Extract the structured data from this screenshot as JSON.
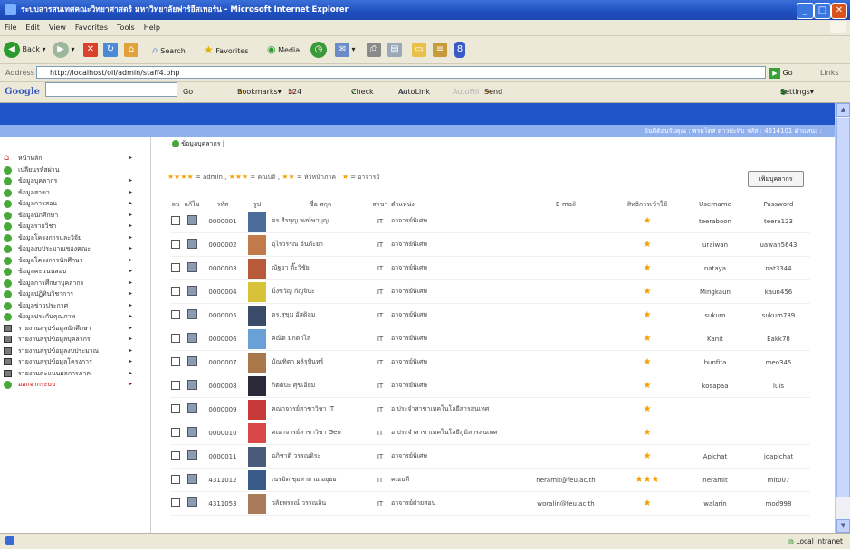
{
  "window": {
    "title": "ระบบสารสนเทศคณะวิทยาศาสตร์ มหาวิทยาลัยฟาร์อีสเทอร์น - Microsoft Internet Explorer",
    "minimize": "_",
    "maximize": "□",
    "close": "✕"
  },
  "menu": [
    "File",
    "Edit",
    "View",
    "Favorites",
    "Tools",
    "Help"
  ],
  "toolbar": {
    "back": "Back",
    "search": "Search",
    "favorites": "Favorites",
    "media": "Media"
  },
  "address": {
    "label": "Address",
    "url": "http://localhost/oil/admin/staff4.php",
    "go": "Go",
    "links": "Links"
  },
  "google": {
    "logo": "Google",
    "go": "Go",
    "bookmarks": "Bookmarks▾",
    "blocked": "324 blocked",
    "check": "Check ▾",
    "autolink": "AutoLink ▾",
    "autofill": "AutoFill",
    "sendto": "Send to▾",
    "settings": "Settings▾"
  },
  "header": {
    "welcome": "ยินดีต้อนรับคุณ : พรมโตศ ตาวปะทิบ รหัส : 4514101 ตำแหน่ง :"
  },
  "sidebar": [
    {
      "label": "หน้าหลัก",
      "icon": "home",
      "arrow": "▸"
    },
    {
      "label": "เปลี่ยนรหัสผ่าน",
      "icon": "dot",
      "arrow": ""
    },
    {
      "label": "ข้อมูลบุคลากร",
      "icon": "dot",
      "arrow": "▸"
    },
    {
      "label": "ข้อมูลสาขา",
      "icon": "dot",
      "arrow": "▸"
    },
    {
      "label": "ข้อมูลการสอน",
      "icon": "dot",
      "arrow": "▸"
    },
    {
      "label": "ข้อมูลนักศึกษา",
      "icon": "dot",
      "arrow": "▸"
    },
    {
      "label": "ข้อมูลรายวิชา",
      "icon": "dot",
      "arrow": "▸"
    },
    {
      "label": "ข้อมูลโครงการและวิจัย",
      "icon": "dot",
      "arrow": "▸"
    },
    {
      "label": "ข้อมูลงบประมาณของคณะ",
      "icon": "dot",
      "arrow": "▸"
    },
    {
      "label": "ข้อมูลโครงการนักศึกษา",
      "icon": "dot",
      "arrow": "▸"
    },
    {
      "label": "ข้อมูลคะแนนสอบ",
      "icon": "dot",
      "arrow": "▸"
    },
    {
      "label": "ข้อมูลการศึกษาบุคลากร",
      "icon": "dot",
      "arrow": "▸"
    },
    {
      "label": "ข้อมูลปฏิทินวิชาการ",
      "icon": "dot",
      "arrow": "▸"
    },
    {
      "label": "ข้อมูลข่าวประกาศ",
      "icon": "dot",
      "arrow": "▸"
    },
    {
      "label": "ข้อมูลประกันคุณภาพ",
      "icon": "dot",
      "arrow": "▸"
    },
    {
      "label": "รายงานสรุปข้อมูลนักศึกษา",
      "icon": "book",
      "arrow": "▸"
    },
    {
      "label": "รายงานสรุปข้อมูลบุคลากร",
      "icon": "book",
      "arrow": "▸"
    },
    {
      "label": "รายงานสรุปข้อมูลงบประมาณ",
      "icon": "book",
      "arrow": "▸"
    },
    {
      "label": "รายงานสรุปข้อมูลโครงการ",
      "icon": "book",
      "arrow": "▸"
    },
    {
      "label": "รายงานคะแนนผลการภาค",
      "icon": "book",
      "arrow": "▸"
    },
    {
      "label": "ออกจากระบบ",
      "icon": "dot",
      "arrow": "▸"
    }
  ],
  "content": {
    "breadcrumb": "ข้อมูลบุคลากร |",
    "legend": {
      "s4": "★★★★",
      "l4": "= admin ,",
      "s3": "★★★",
      "l3": "= คณบดี ,",
      "s2": "★★",
      "l2": "= หัวหน้าภาค ,",
      "s1": "★",
      "l1": "= อาจารย์"
    },
    "add_button": "เพิ่มบุคลากร",
    "columns": [
      "ลบ",
      "แก้ไข",
      "รหัส",
      "รูป",
      "ชื่อ-สกุล",
      "สาขา",
      "ตำแหน่ง",
      "E-mail",
      "สิทธิการเข้าใช้",
      "Username",
      "Password"
    ],
    "rows": [
      {
        "id": "0000001",
        "name": "ดร.ธีรบุญ พงษ์ษาบุญ",
        "branch": "IT",
        "position": "อาจารย์พิเศษ",
        "email": "",
        "stars": "★",
        "username": "teeraboon",
        "password": "teera123"
      },
      {
        "id": "0000002",
        "name": "อุไรวรรณ อินต๊ะยา",
        "branch": "IT",
        "position": "อาจารย์พิเศษ",
        "email": "",
        "stars": "★",
        "username": "uraiwan",
        "password": "uawan5643"
      },
      {
        "id": "0000003",
        "name": "ณัฐยา ตั๊ะวิชัย",
        "branch": "IT",
        "position": "อาจารย์พิเศษ",
        "email": "",
        "stars": "★",
        "username": "nataya",
        "password": "nat3344"
      },
      {
        "id": "0000004",
        "name": "มิ่งขวัญ กัญจินะ",
        "branch": "IT",
        "position": "อาจารย์พิเศษ",
        "email": "",
        "stars": "★",
        "username": "Mingkaun",
        "password": "kaun456"
      },
      {
        "id": "0000005",
        "name": "ดร.สุขุม อัสดิลม",
        "branch": "IT",
        "position": "อาจารย์พิเศษ",
        "email": "",
        "stars": "★",
        "username": "sukum",
        "password": "sukum789"
      },
      {
        "id": "0000006",
        "name": "คณิต มุกดาไล",
        "branch": "IT",
        "position": "อาจารย์พิเศษ",
        "email": "",
        "stars": "★",
        "username": "Kanit",
        "password": "Eakk78"
      },
      {
        "id": "0000007",
        "name": "บัณฑิตา ผลิรุปันทร์",
        "branch": "IT",
        "position": "อาจารย์พิเศษ",
        "email": "",
        "stars": "★",
        "username": "bunfita",
        "password": "meo345"
      },
      {
        "id": "0000008",
        "name": "กิตติปะ ศุขเอียม",
        "branch": "IT",
        "position": "อาจารย์พิเศษ",
        "email": "",
        "stars": "★",
        "username": "kosapaa",
        "password": "luis"
      },
      {
        "id": "0000009",
        "name": "คณาจารย์สาขาวิชา IT",
        "branch": "IT",
        "position": "อ.ประจำสาขาเทคโนโลยีสารสนเทศ",
        "email": "",
        "stars": "★",
        "username": "",
        "password": ""
      },
      {
        "id": "0000010",
        "name": "คณาจารย์สาขาวิชา Geo",
        "branch": "IT",
        "position": "อ.ประจำสาขาเทคโนโลยีภูมิสารสนเทศ",
        "email": "",
        "stars": "★",
        "username": "",
        "password": ""
      },
      {
        "id": "0000011",
        "name": "อภิชาติ วรรณดิระ",
        "branch": "IT",
        "position": "อาจารย์พิเศษ",
        "email": "",
        "stars": "★",
        "username": "Apichat",
        "password": "joapichat"
      },
      {
        "id": "4311012",
        "name": "เนรมิต ชุมสาย ณ อยุธยา",
        "branch": "IT",
        "position": "คณบดี",
        "email": "neramit@feu.ac.th",
        "stars": "★★★",
        "username": "neramit",
        "password": "mit007"
      },
      {
        "id": "4311053",
        "name": "วลัยพรรณ์ วรรณลิน",
        "branch": "IT",
        "position": "อาจารย์ฝ่ายสอน",
        "email": "woralin@feu.ac.th",
        "stars": "★",
        "username": "walarin",
        "password": "mod998"
      }
    ],
    "photo_colors": [
      "#4a6d9a",
      "#c27a4a",
      "#b85a3a",
      "#d8c23a",
      "#3a4c6a",
      "#6aa0d8",
      "#a8784a",
      "#2a2a3a",
      "#c83a3a",
      "#d84848",
      "#4a5a7a",
      "#3a5a8a",
      "#a87a5a"
    ]
  },
  "status": {
    "zone": "Local intranet"
  }
}
